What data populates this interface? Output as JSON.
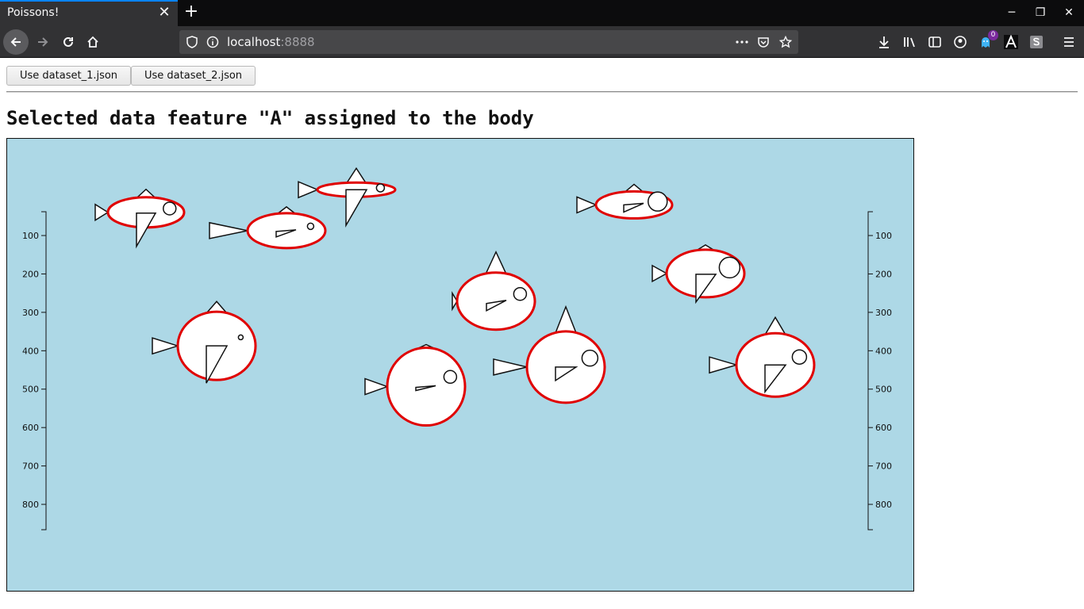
{
  "browser": {
    "tab_title": "Poissons!",
    "url_host": "localhost",
    "url_port": ":8888",
    "extension_badge": "0"
  },
  "page": {
    "buttons": [
      "Use dataset_1.json",
      "Use dataset_2.json"
    ],
    "heading": "Selected data feature \"A\" assigned to the body",
    "canvas_color": "#add8e6",
    "body_stroke_color": "#e00000",
    "axis": {
      "ticks": [
        100,
        200,
        300,
        400,
        500,
        600,
        700,
        800
      ],
      "domain": [
        38,
        866
      ]
    }
  },
  "chart_data": {
    "type": "scatter",
    "title": "Selected data feature \"A\" assigned to the body",
    "ylim": [
      38,
      866
    ],
    "y_axes": [
      "left",
      "right"
    ],
    "fish": [
      {
        "x": 440,
        "y": 72
      },
      {
        "x": 175,
        "y": 167
      },
      {
        "x": 352,
        "y": 244
      },
      {
        "x": 790,
        "y": 136
      },
      {
        "x": 880,
        "y": 424
      },
      {
        "x": 616,
        "y": 540
      },
      {
        "x": 264,
        "y": 728
      },
      {
        "x": 704,
        "y": 817
      },
      {
        "x": 968,
        "y": 808
      },
      {
        "x": 528,
        "y": 899
      }
    ]
  }
}
